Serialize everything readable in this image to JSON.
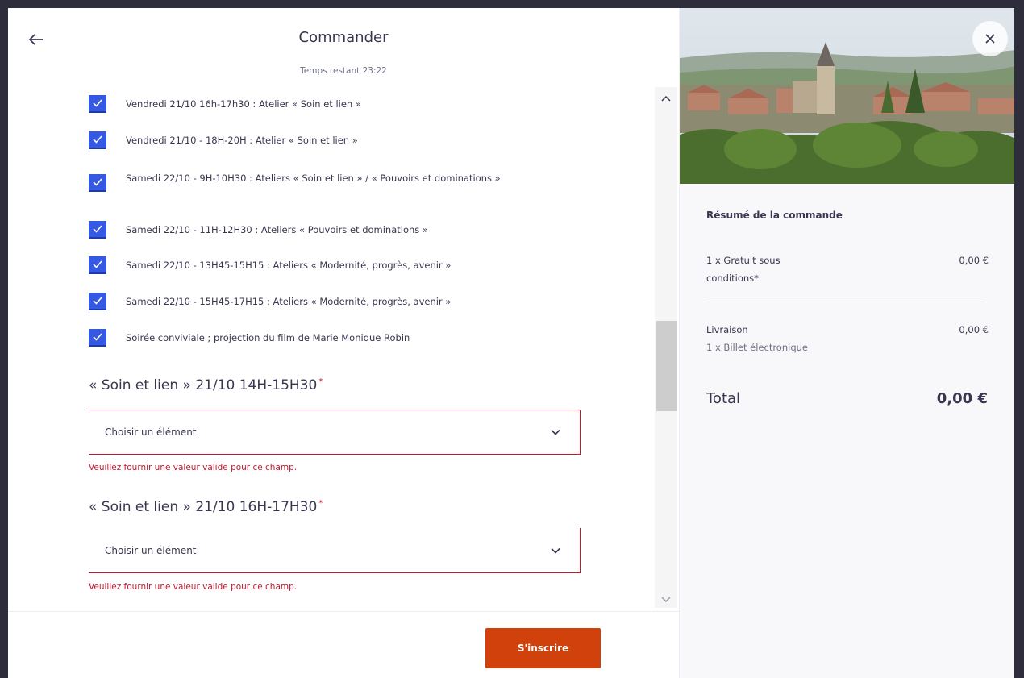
{
  "header": {
    "title": "Commander",
    "timer": "Temps restant  23:22"
  },
  "options": [
    {
      "label": "Vendredi 21/10 16h-17h30 : Atelier « Soin et lien »",
      "checked": true
    },
    {
      "label": "Vendredi 21/10 - 18H-20H : Atelier « Soin et lien »",
      "checked": true
    },
    {
      "label": "Samedi 22/10 - 9H-10H30 : Ateliers « Soin et lien » / « Pouvoirs et dominations »",
      "checked": true
    },
    {
      "label": "Samedi 22/10 - 11H-12H30 : Ateliers « Pouvoirs et dominations »",
      "checked": true
    },
    {
      "label": "Samedi 22/10 - 13H45-15H15 : Ateliers « Modernité, progrès, avenir »",
      "checked": true
    },
    {
      "label": "Samedi 22/10 - 15H45-17H15 : Ateliers « Modernité, progrès, avenir »",
      "checked": true
    },
    {
      "label": "Soirée conviviale ; projection du film de Marie Monique Robin",
      "checked": true
    }
  ],
  "fields": [
    {
      "title": "« Soin et lien » 21/10 14H-15H30",
      "required_mark": "*",
      "placeholder": "Choisir un élément",
      "error": "Veuillez fournir une valeur valide pour ce champ."
    },
    {
      "title": "« Soin et lien » 21/10 16H-17H30",
      "required_mark": "*",
      "placeholder": "Choisir un élément",
      "error": "Veuillez fournir une valeur valide pour ce champ."
    }
  ],
  "footer": {
    "submit_label": "S'inscrire"
  },
  "summary": {
    "title": "Résumé de la commande",
    "items": [
      {
        "name": "1 x Gratuit sous conditions*",
        "amount": "0,00 €"
      }
    ],
    "delivery": {
      "name": "Livraison",
      "amount": "0,00 €",
      "detail": "1 x Billet électronique"
    },
    "total_label": "Total",
    "total_amount": "0,00 €"
  },
  "colors": {
    "accent": "#d1410c",
    "checkbox": "#3659e3",
    "error": "#c5162e",
    "text": "#39364f"
  },
  "icons": [
    "back-arrow-icon",
    "close-icon",
    "check-icon",
    "chevron-down-icon",
    "chevron-up-icon"
  ]
}
